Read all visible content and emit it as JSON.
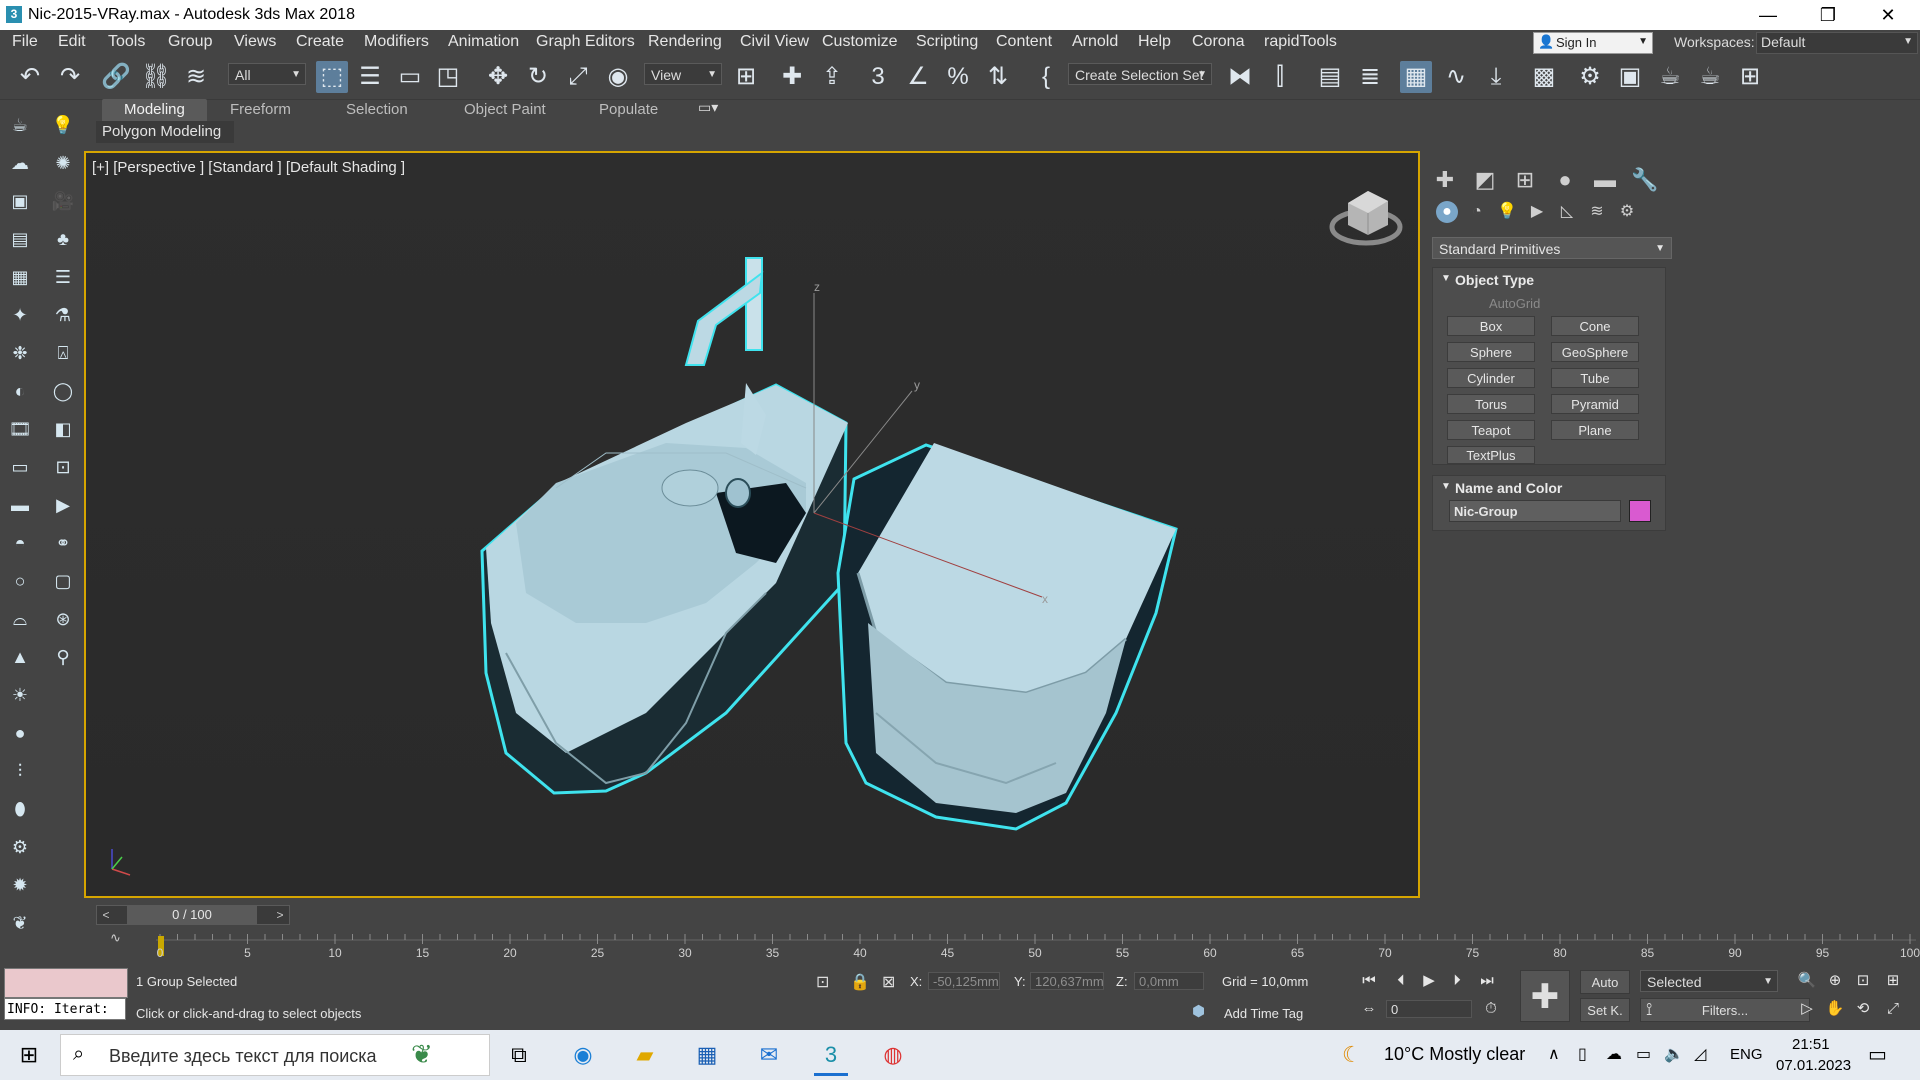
{
  "window": {
    "app_icon": "3",
    "title": "Nic-2015-VRay.max - Autodesk 3ds Max 2018",
    "min_label": "—",
    "max_label": "❐",
    "close_label": "✕"
  },
  "menu": [
    "File",
    "Edit",
    "Tools",
    "Group",
    "Views",
    "Create",
    "Modifiers",
    "Animation",
    "Graph Editors",
    "Rendering",
    "Civil View",
    "Customize",
    "Scripting",
    "Content",
    "Arnold",
    "Help",
    "Corona",
    "rapidTools"
  ],
  "account": {
    "sign_in": "Sign In",
    "workspaces_label": "Workspaces:",
    "workspace_value": "Default"
  },
  "toolbar": {
    "selection_filter": "All",
    "ref_coord": "View",
    "named_selection": "Create Selection Set"
  },
  "ribbon": {
    "tabs": [
      "Modeling",
      "Freeform",
      "Selection",
      "Object Paint",
      "Populate"
    ],
    "active_tab": "Modeling",
    "subpanel": "Polygon Modeling"
  },
  "viewport": {
    "label": "[+] [Perspective ] [Standard ] [Default Shading ]",
    "axis_x": "x",
    "axis_y": "y",
    "axis_z": "z"
  },
  "command_panel": {
    "category": "Standard Primitives",
    "object_type": {
      "title": "Object Type",
      "autogrid": "AutoGrid",
      "buttons": [
        "Box",
        "Cone",
        "Sphere",
        "GeoSphere",
        "Cylinder",
        "Tube",
        "Torus",
        "Pyramid",
        "Teapot",
        "Plane",
        "TextPlus"
      ]
    },
    "name_color": {
      "title": "Name and Color",
      "name": "Nic-Group",
      "color": "#d95ad0"
    }
  },
  "timeline": {
    "frame": "0 / 100",
    "ticks": [
      "0",
      "5",
      "10",
      "15",
      "20",
      "25",
      "30",
      "35",
      "40",
      "45",
      "50",
      "55",
      "60",
      "65",
      "70",
      "75",
      "80",
      "85",
      "90",
      "95",
      "100"
    ]
  },
  "status": {
    "info": "INFO: Iterat:",
    "selection": "1 Group Selected",
    "prompt": "Click or click-and-drag to select objects",
    "x_label": "X:",
    "x_value": "-50,125mm",
    "y_label": "Y:",
    "y_value": "120,637mm",
    "z_label": "Z:",
    "z_value": "0,0mm",
    "grid": "Grid = 10,0mm",
    "add_time_tag": "Add Time Tag",
    "auto_key": "Auto",
    "set_key": "Set K.",
    "key_filter": "Selected",
    "filters": "Filters...",
    "current_frame": "0"
  },
  "taskbar": {
    "search_placeholder": "Введите здесь текст для поиска",
    "weather": "10°C  Mostly clear",
    "lang": "ENG",
    "time": "21:51",
    "date": "07.01.2023"
  }
}
